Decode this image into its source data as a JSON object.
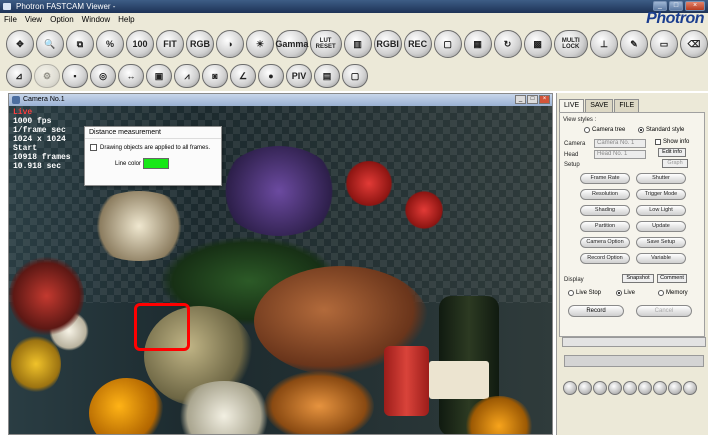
{
  "window": {
    "title": "Photron FASTCAM Viewer -",
    "minimize": "_",
    "maximize": "□",
    "close": "×"
  },
  "logo": "Photron",
  "menu": [
    "File",
    "View",
    "Option",
    "Window",
    "Help"
  ],
  "toolbar1": [
    {
      "icon": "move-icon",
      "label": "✥"
    },
    {
      "icon": "zoom-icon",
      "label": "🔍"
    },
    {
      "icon": "crop-icon",
      "label": "⧉"
    },
    {
      "icon": "percent-icon",
      "label": "%"
    },
    {
      "icon": "zoom-100-icon",
      "label": "100"
    },
    {
      "icon": "fit-icon",
      "label": "FIT"
    },
    {
      "icon": "rgb-icon",
      "label": "RGB"
    },
    {
      "icon": "contrast-icon",
      "label": "◑"
    },
    {
      "icon": "brightness-icon",
      "label": "☀"
    },
    {
      "icon": "gamma-icon",
      "label": "Gamma"
    },
    {
      "icon": "lut-reset-icon",
      "label": "LUT RESET"
    },
    {
      "icon": "color-bars-icon",
      "label": "▥"
    },
    {
      "icon": "rgbi-icon",
      "label": "RGBI"
    },
    {
      "icon": "record-icon",
      "label": "REC"
    },
    {
      "icon": "frame-icon",
      "label": "▢"
    },
    {
      "icon": "grid-icon",
      "label": "▦"
    },
    {
      "icon": "refresh-icon",
      "label": "↻"
    },
    {
      "icon": "multi-camera-icon",
      "label": "▩"
    },
    {
      "icon": "multi-lock-icon",
      "label": "MULTI LOCK"
    },
    {
      "icon": "trigger-icon",
      "label": "⊥"
    },
    {
      "icon": "pen-icon",
      "label": "✎"
    },
    {
      "icon": "keyboard-icon",
      "label": "▭"
    },
    {
      "icon": "eraser-icon",
      "label": "⌫"
    }
  ],
  "toolbar2": [
    {
      "icon": "measure-icon",
      "label": "⊿",
      "dim": false
    },
    {
      "icon": "settings-disabled-icon",
      "label": "⚙",
      "dim": true
    },
    {
      "icon": "shapes-icon",
      "label": "▪",
      "dim": false
    },
    {
      "icon": "tracking-icon",
      "label": "◎",
      "dim": false
    },
    {
      "icon": "distance-icon",
      "label": "↔",
      "dim": false
    },
    {
      "icon": "image-icon",
      "label": "▣",
      "dim": false
    },
    {
      "icon": "graph-icon",
      "label": "⩘",
      "dim": false
    },
    {
      "icon": "camera-icon",
      "label": "◙",
      "dim": false
    },
    {
      "icon": "angle-icon",
      "label": "∠",
      "dim": false
    },
    {
      "icon": "point-icon",
      "label": "●",
      "dim": false
    },
    {
      "icon": "piv-icon",
      "label": "PIV",
      "dim": false
    },
    {
      "icon": "database-icon",
      "label": "▤",
      "dim": false
    },
    {
      "icon": "blank-icon",
      "label": "▢",
      "dim": false
    }
  ],
  "camera_window": {
    "title": "Camera No.1",
    "overlay": {
      "line0": "Live",
      "line1": "1000 fps",
      "line2": "1/frame sec",
      "line3": "1024 x 1024",
      "line4": "Start",
      "line5": "10918 frames",
      "line6": "10.918 sec"
    },
    "distance_dialog": {
      "title": "Distance measurement",
      "checkbox_label": "Drawing objects are applied to all frames.",
      "line_color_label": "Line color",
      "line_color": "#17e817"
    },
    "highlight_color": "#ff0000"
  },
  "panel": {
    "tabs": [
      "LIVE",
      "SAVE",
      "FILE"
    ],
    "view_styles_label": "View styles :",
    "camera_tree": "Camera tree",
    "standard_style": "Standard style",
    "camera_label": "Camera",
    "camera_value": "Camera No. 1",
    "head_label": "Head",
    "head_value": "Head No. 1",
    "show_info": "Show info",
    "edit_info": "Edit info",
    "graph": "Graph",
    "setup_label": "Setup",
    "setup_buttons": [
      [
        "Frame Rate",
        "Shutter"
      ],
      [
        "Resolution",
        "Trigger Mode"
      ],
      [
        "Shading",
        "Low Light"
      ],
      [
        "Partition",
        "Update"
      ],
      [
        "Camera Option",
        "Save Setup"
      ],
      [
        "Record Option",
        "Variable"
      ]
    ],
    "display_label": "Display",
    "snapshot": "Snapshot",
    "comment": "Comment",
    "live_stop": "Live Stop",
    "live": "Live",
    "memory": "Memory",
    "record": "Record",
    "cancel": "Cancel"
  }
}
